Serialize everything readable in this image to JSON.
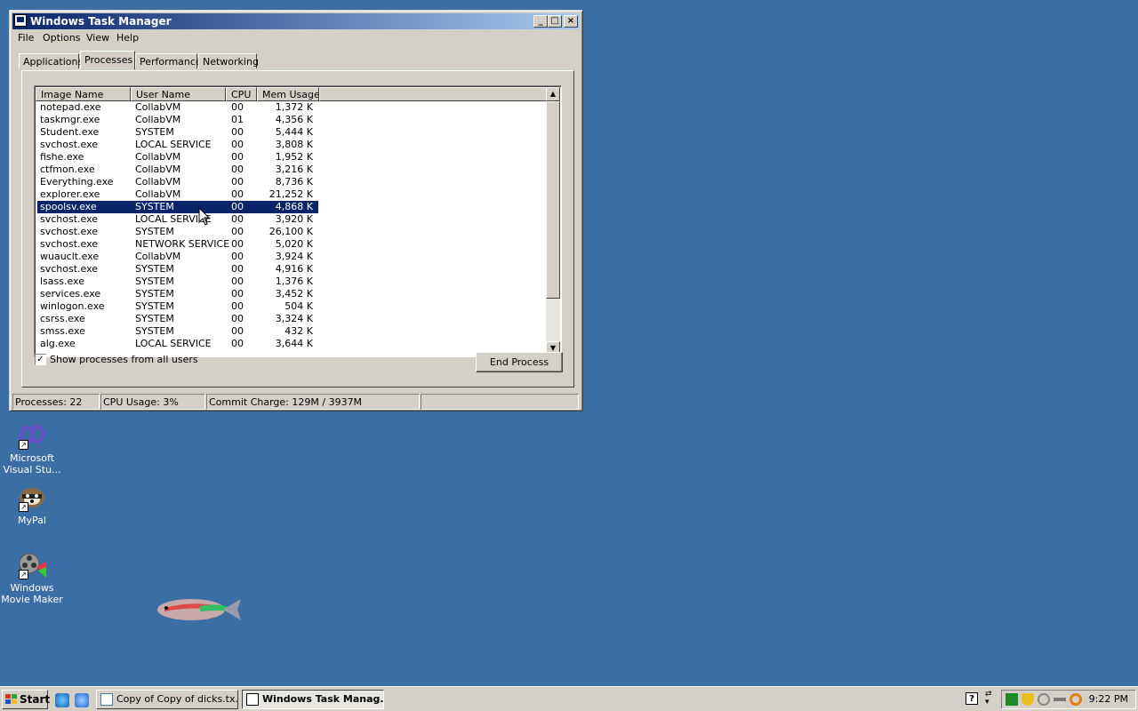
{
  "window": {
    "title": "Windows Task Manager",
    "controls": {
      "minimize": "_",
      "maximize": "□",
      "close": "×"
    }
  },
  "menu": [
    "File",
    "Options",
    "View",
    "Help"
  ],
  "tabs": [
    "Applications",
    "Processes",
    "Performance",
    "Networking"
  ],
  "active_tab": "Processes",
  "columns": [
    "Image Name",
    "User Name",
    "CPU",
    "Mem Usage"
  ],
  "processes": [
    {
      "image": "notepad.exe",
      "user": "CollabVM",
      "cpu": "00",
      "mem": "1,372 K"
    },
    {
      "image": "taskmgr.exe",
      "user": "CollabVM",
      "cpu": "01",
      "mem": "4,356 K"
    },
    {
      "image": "Student.exe",
      "user": "SYSTEM",
      "cpu": "00",
      "mem": "5,444 K"
    },
    {
      "image": "svchost.exe",
      "user": "LOCAL SERVICE",
      "cpu": "00",
      "mem": "3,808 K"
    },
    {
      "image": "fishe.exe",
      "user": "CollabVM",
      "cpu": "00",
      "mem": "1,952 K"
    },
    {
      "image": "ctfmon.exe",
      "user": "CollabVM",
      "cpu": "00",
      "mem": "3,216 K"
    },
    {
      "image": "Everything.exe",
      "user": "CollabVM",
      "cpu": "00",
      "mem": "8,736 K"
    },
    {
      "image": "explorer.exe",
      "user": "CollabVM",
      "cpu": "00",
      "mem": "21,252 K"
    },
    {
      "image": "spoolsv.exe",
      "user": "SYSTEM",
      "cpu": "00",
      "mem": "4,868 K",
      "selected": true
    },
    {
      "image": "svchost.exe",
      "user": "LOCAL SERVICE",
      "cpu": "00",
      "mem": "3,920 K"
    },
    {
      "image": "svchost.exe",
      "user": "SYSTEM",
      "cpu": "00",
      "mem": "26,100 K"
    },
    {
      "image": "svchost.exe",
      "user": "NETWORK SERVICE",
      "cpu": "00",
      "mem": "5,020 K"
    },
    {
      "image": "wuauclt.exe",
      "user": "CollabVM",
      "cpu": "00",
      "mem": "3,924 K"
    },
    {
      "image": "svchost.exe",
      "user": "SYSTEM",
      "cpu": "00",
      "mem": "4,916 K"
    },
    {
      "image": "lsass.exe",
      "user": "SYSTEM",
      "cpu": "00",
      "mem": "1,376 K"
    },
    {
      "image": "services.exe",
      "user": "SYSTEM",
      "cpu": "00",
      "mem": "3,452 K"
    },
    {
      "image": "winlogon.exe",
      "user": "SYSTEM",
      "cpu": "00",
      "mem": "504 K"
    },
    {
      "image": "csrss.exe",
      "user": "SYSTEM",
      "cpu": "00",
      "mem": "3,324 K"
    },
    {
      "image": "smss.exe",
      "user": "SYSTEM",
      "cpu": "00",
      "mem": "432 K"
    },
    {
      "image": "alg.exe",
      "user": "LOCAL SERVICE",
      "cpu": "00",
      "mem": "3,644 K"
    }
  ],
  "show_all_users": {
    "label": "Show processes from all users",
    "checked": true
  },
  "end_process_label": "End Process",
  "status": {
    "processes": "Processes: 22",
    "cpu": "CPU Usage: 3%",
    "commit": "Commit Charge: 129M / 3937M"
  },
  "desktop_icons": [
    {
      "label": "Microsoft Visual Stu...",
      "icon": "visual-studio-icon"
    },
    {
      "label": "MyPal",
      "icon": "mypal-icon"
    },
    {
      "label": "Windows Movie Maker",
      "icon": "movie-maker-icon"
    }
  ],
  "taskbar": {
    "start_label": "Start",
    "quick_launch": [
      "internet-explorer-icon",
      "show-desktop-icon"
    ],
    "tasks": [
      {
        "label": "Copy of Copy of dicks.tx...",
        "icon": "notepad-icon",
        "active": false
      },
      {
        "label": "Windows Task Manag...",
        "icon": "task-manager-icon",
        "active": true
      }
    ],
    "clock": "9:22 PM"
  },
  "colors": {
    "desktop": "#3a6ea5",
    "title_active": "#0a246a",
    "selection": "#0a246a",
    "face": "#d4d0c8"
  }
}
